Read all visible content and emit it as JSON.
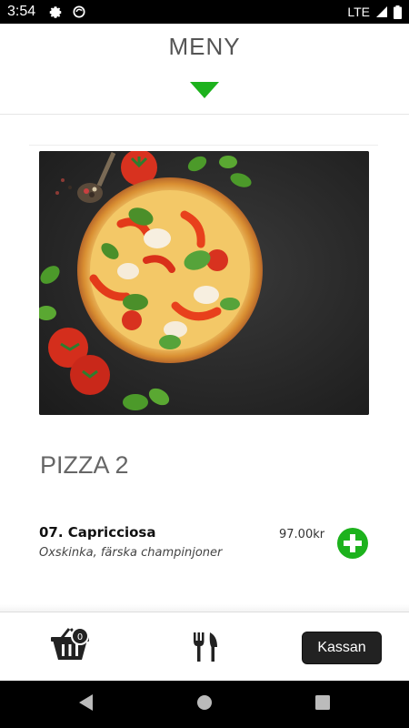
{
  "status_bar": {
    "time": "3:54",
    "network": "LTE",
    "icons": [
      "settings-icon",
      "sync-icon",
      "signal-icon",
      "battery-icon"
    ]
  },
  "header": {
    "title": "MENY",
    "toggle_icon": "triangle-down-icon",
    "accent_color": "#1db21d"
  },
  "hero": {
    "image": "pizza-photo"
  },
  "category": {
    "title": "PIZZA 2"
  },
  "menu_items": [
    {
      "name": "07. Capricciosa",
      "description": "Oxskinka, färska champinjoner",
      "price": "97.00kr",
      "add_icon": "plus-circle-icon"
    }
  ],
  "bottom_bar": {
    "cart_icon": "basket-icon",
    "cart_count": "0",
    "menu_icon": "fork-knife-icon",
    "checkout_label": "Kassan"
  },
  "nav_bar": {
    "icons": [
      "back-icon",
      "home-icon",
      "recents-icon"
    ]
  }
}
